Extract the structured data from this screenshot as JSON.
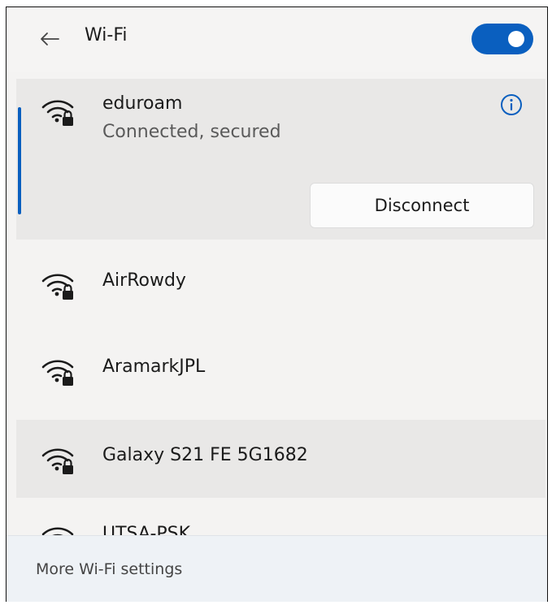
{
  "header": {
    "title": "Wi-Fi",
    "toggle_on": true,
    "accent_color": "#0a5fbf"
  },
  "connected_network": {
    "name": "eduroam",
    "status": "Connected, secured",
    "disconnect_label": "Disconnect",
    "icon": "wifi-lock-icon"
  },
  "networks": [
    {
      "name": "AirRowdy",
      "icon": "wifi-lock-icon"
    },
    {
      "name": "AramarkJPL",
      "icon": "wifi-lock-icon"
    },
    {
      "name": "Galaxy S21 FE 5G1682",
      "icon": "wifi-lock-icon"
    },
    {
      "name": "UTSA-PSK",
      "icon": "wifi-lock-icon"
    }
  ],
  "footer": {
    "settings_label": "More Wi-Fi settings"
  }
}
